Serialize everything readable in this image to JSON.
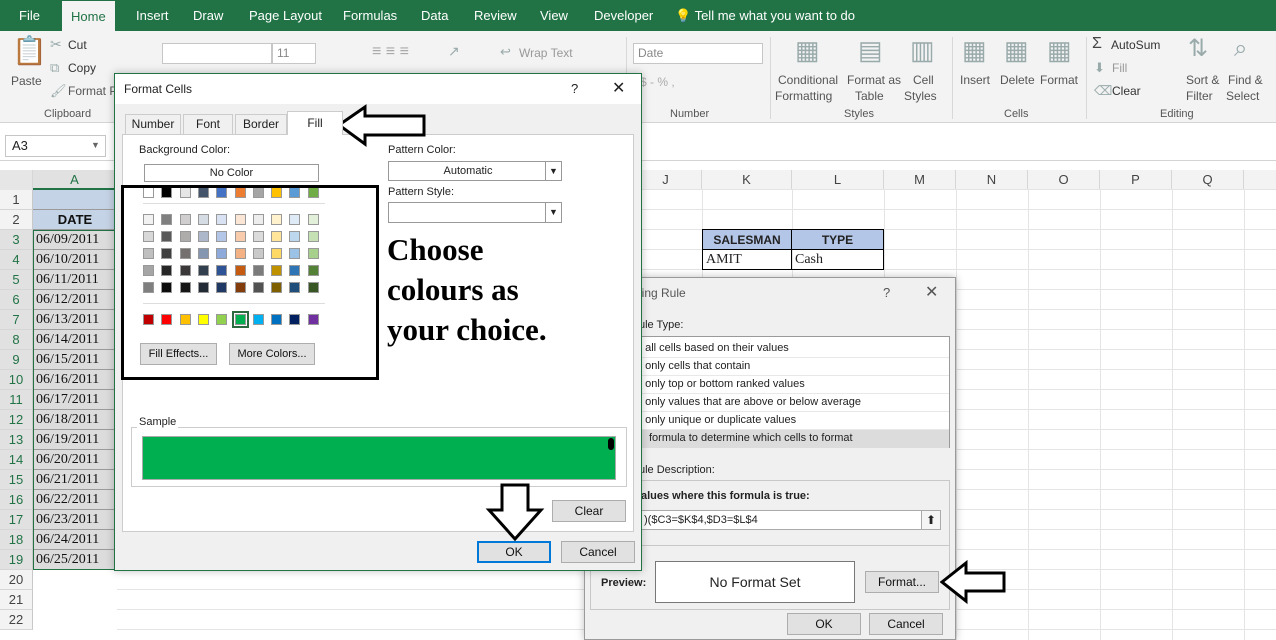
{
  "tabs": [
    "File",
    "Home",
    "Insert",
    "Draw",
    "Page Layout",
    "Formulas",
    "Data",
    "Review",
    "View",
    "Developer"
  ],
  "tell_me": "Tell me what you want to do",
  "clipboard": {
    "paste": "Paste",
    "cut": "Cut",
    "copy": "Copy",
    "format_painter": "Format P",
    "label": "Clipboard"
  },
  "font": {
    "size": "11"
  },
  "alignment": {
    "wrap": "Wrap Text"
  },
  "number": {
    "format": "Date",
    "label": "Number",
    "symbols": "$ - % ,"
  },
  "styles": {
    "cond1": "Conditional",
    "cond2": "Formatting",
    "fmt1": "Format as",
    "fmt2": "Table",
    "cell1": "Cell",
    "cell2": "Styles",
    "label": "Styles"
  },
  "cells": {
    "insert": "Insert",
    "delete": "Delete",
    "format": "Format",
    "label": "Cells"
  },
  "editing": {
    "autosum": "AutoSum",
    "fill": "Fill",
    "clear": "Clear",
    "sort1": "Sort &",
    "sort2": "Filter",
    "find1": "Find &",
    "find2": "Select",
    "label": "Editing"
  },
  "name_box": "A3",
  "columns": [
    "A",
    "J",
    "K",
    "L",
    "M",
    "N",
    "O",
    "P",
    "Q"
  ],
  "rows": [
    "1",
    "2",
    "3",
    "4",
    "5",
    "6",
    "7",
    "8",
    "9",
    "10",
    "11",
    "12",
    "13",
    "14",
    "15",
    "16",
    "17",
    "18",
    "19",
    "20",
    "21",
    "22"
  ],
  "header_date": "DATE",
  "dates": [
    "06/09/2011",
    "06/10/2011",
    "06/11/2011",
    "06/12/2011",
    "06/13/2011",
    "06/14/2011",
    "06/15/2011",
    "06/16/2011",
    "06/17/2011",
    "06/18/2011",
    "06/19/2011",
    "06/20/2011",
    "06/21/2011",
    "06/22/2011",
    "06/23/2011",
    "06/24/2011",
    "06/25/2011"
  ],
  "lookup": {
    "h1": "SALESMAN",
    "h2": "TYPE",
    "v1": "AMIT",
    "v2": "Cash"
  },
  "rule": {
    "title": "tting Rule",
    "help": "?",
    "select_type": "ule Type:",
    "types": [
      "t all cells based on their values",
      "t only cells that contain",
      "t only top or bottom ranked values",
      "t only values that are above or below average",
      "t only unique or duplicate values",
      "formula to determine which cells to format"
    ],
    "desc": "ule Description:",
    "formula_label": "alues where this formula is true:",
    "formula": ")($C3=$K$4,$D3=$L$4",
    "preview_label": "Preview:",
    "preview": "No Format Set",
    "format": "Format...",
    "ok": "OK",
    "cancel": "Cancel"
  },
  "fc": {
    "title": "Format Cells",
    "help": "?",
    "tabs": [
      "Number",
      "Font",
      "Border",
      "Fill"
    ],
    "bg_label": "Background Color:",
    "no_color": "No Color",
    "pattern_color_label": "Pattern Color:",
    "pattern_color": "Automatic",
    "pattern_style_label": "Pattern Style:",
    "fill_effects": "Fill Effects...",
    "more_colors": "More Colors...",
    "sample": "Sample",
    "clear": "Clear",
    "ok": "OK",
    "cancel": "Cancel",
    "sample_color": "#00b050"
  },
  "annotation": [
    "Choose",
    "colours as",
    "your choice."
  ],
  "palette": {
    "row0": [
      "#ffffff",
      "#000000",
      "#e7e6e6",
      "#44546a",
      "#4472c4",
      "#ed7d31",
      "#a5a5a5",
      "#ffc000",
      "#5b9bd5",
      "#70ad47"
    ],
    "tints": [
      [
        "#f2f2f2",
        "#7f7f7f",
        "#d0cece",
        "#d6dce4",
        "#d9e2f3",
        "#fbe5d5",
        "#ededed",
        "#fff2cc",
        "#deebf6",
        "#e2efd9"
      ],
      [
        "#d8d8d8",
        "#595959",
        "#aeabab",
        "#adb9ca",
        "#b4c6e7",
        "#f7cbac",
        "#dbdbdb",
        "#fee599",
        "#bdd7ee",
        "#c5e0b3"
      ],
      [
        "#bfbfbf",
        "#3f3f3f",
        "#757070",
        "#8496b0",
        "#8eaadb",
        "#f4b183",
        "#c9c9c9",
        "#ffd965",
        "#9cc3e5",
        "#a8d08d"
      ],
      [
        "#a5a5a5",
        "#262626",
        "#3a3838",
        "#323f4f",
        "#2f5496",
        "#c55a11",
        "#7b7b7b",
        "#bf9000",
        "#2e75b5",
        "#538135"
      ],
      [
        "#7f7f7f",
        "#0c0c0c",
        "#171616",
        "#222a35",
        "#1f3864",
        "#833c0b",
        "#525252",
        "#7f6000",
        "#1e4e79",
        "#375623"
      ]
    ],
    "standard": [
      "#c00000",
      "#ff0000",
      "#ffc000",
      "#ffff00",
      "#92d050",
      "#00b050",
      "#00b0f0",
      "#0070c0",
      "#002060",
      "#7030a0"
    ]
  }
}
